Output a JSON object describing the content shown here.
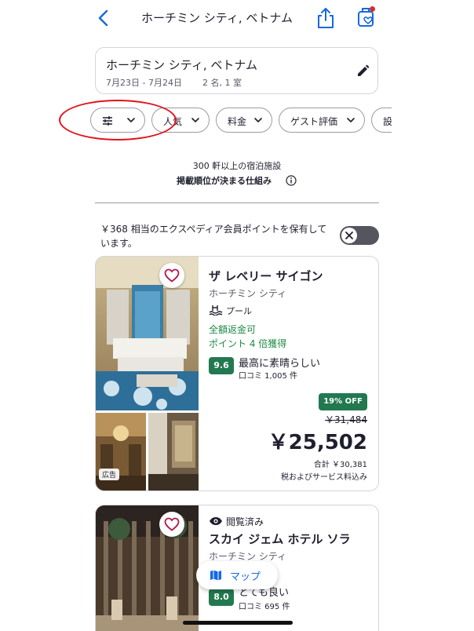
{
  "header": {
    "title": "ホーチミン シティ, ベトナム",
    "back_icon": "chevron-left-icon",
    "share_icon": "share-icon",
    "trips_icon": "saved-trips-icon",
    "accent_color": "#1668e3",
    "notification_color": "#d32f2f"
  },
  "search": {
    "destination": "ホーチミン シティ, ベトナム",
    "dates": "7月23日 - 7月24日",
    "guests": "2 名, 1 室",
    "edit_icon": "pencil-icon"
  },
  "filters": [
    {
      "label": "",
      "icon": "sliders-icon"
    },
    {
      "label": "人気"
    },
    {
      "label": "料金"
    },
    {
      "label": "ゲスト評価"
    },
    {
      "label": "設"
    }
  ],
  "results": {
    "count_text": "300 軒以上の宿泊施設",
    "ranking_link": "掲載順位が決まる仕組み",
    "info_icon": "info-icon"
  },
  "points": {
    "text": "￥368 相当のエクスペディア会員ポイントを保有しています。",
    "toggle_on": false
  },
  "hotels": [
    {
      "name": "ザ レベリー サイゴン",
      "city": "ホーチミン シティ",
      "amenity": "プール",
      "amenity_icon": "pool-icon",
      "refund": "全額返金可",
      "points_offer": "ポイント 4 倍獲得",
      "score": "9.6",
      "score_text": "最高に素晴らしい",
      "reviews": "口コミ 1,005 件",
      "discount": "19% OFF",
      "original_price": "￥31,484",
      "price": "￥25,502",
      "total": "合計 ￥30,381",
      "tax_note": "税およびサービス料込み",
      "ad_label": "広告",
      "favorite_icon": "heart-icon"
    },
    {
      "viewed": "閲覧済み",
      "viewed_icon": "eye-icon",
      "name": "スカイ ジェム ホテル ソラ",
      "city": "ホーチミン シティ",
      "score": "8.0",
      "score_text": "とても良い",
      "reviews": "口コミ 695 件",
      "favorite_icon": "heart-icon"
    }
  ],
  "map_button": {
    "label": "マップ",
    "icon": "map-icon"
  },
  "colors": {
    "score_green": "#227950",
    "offer_green": "#1e8a44",
    "annotation_red": "#e0141e",
    "favorite": "#b3174b"
  }
}
